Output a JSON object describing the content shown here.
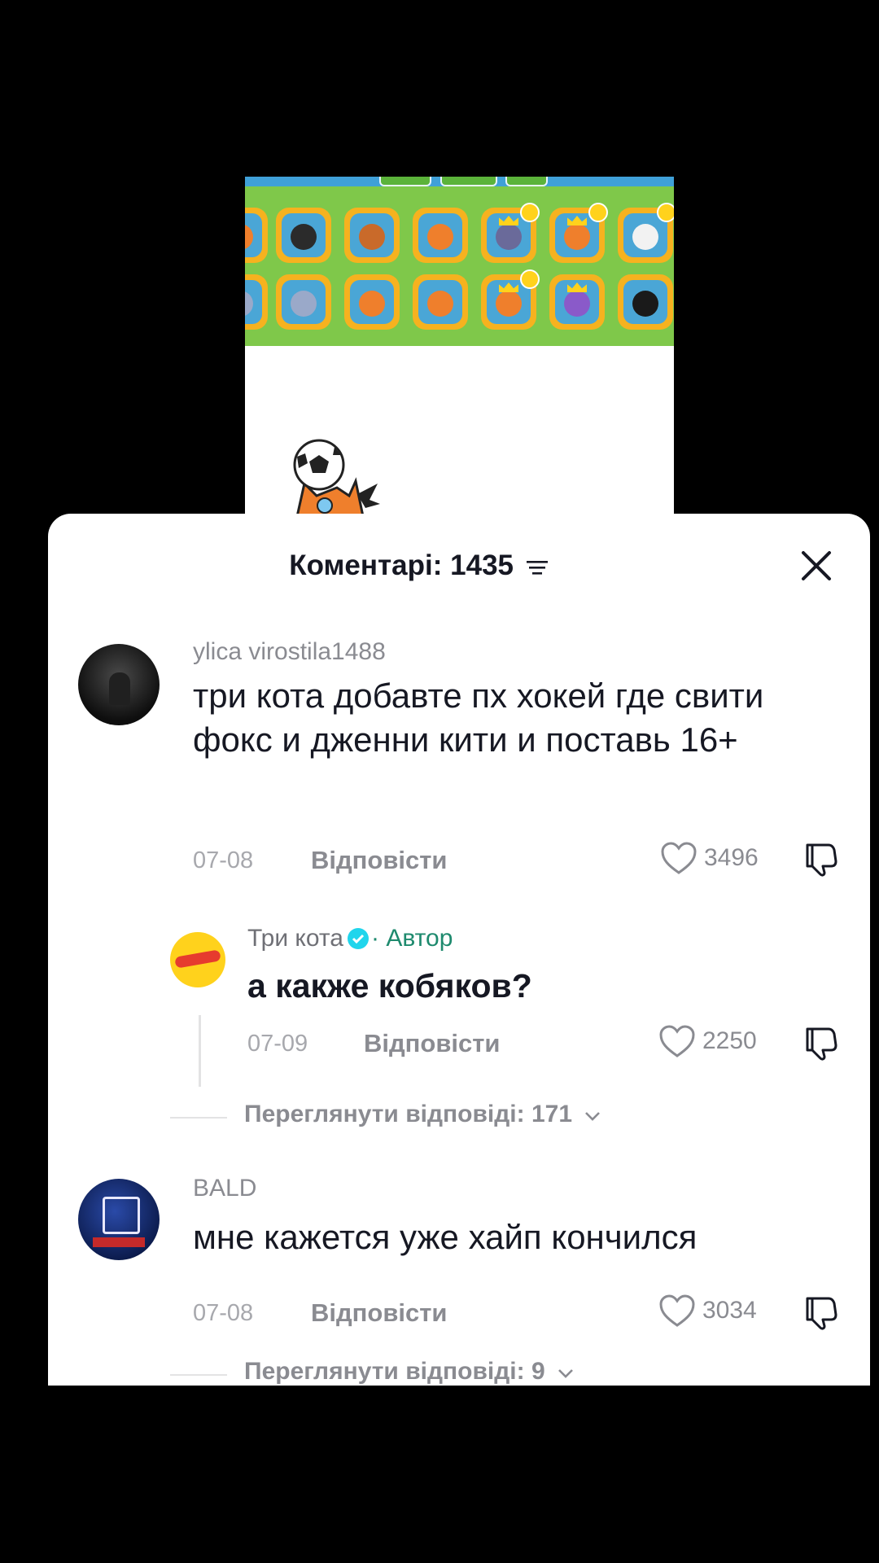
{
  "header": {
    "title": "Коментарі: 1435"
  },
  "comments": [
    {
      "username": "ylica virostila1488",
      "text": "три кота добавте пх хокей где свити фокс и дженни кити и поставь 16+",
      "date": "07-08",
      "reply_label": "Відповісти",
      "likes": "3496",
      "reply": {
        "username": "Три кота",
        "author_tag": "· Автор",
        "text": "а  какже  кобяков?",
        "date": "07-09",
        "reply_label": "Відповісти",
        "likes": "2250"
      },
      "view_replies": "Переглянути відповіді: 171"
    },
    {
      "username": "BALD",
      "text": "мне кажется уже хайп кончился",
      "date": "07-08",
      "reply_label": "Відповісти",
      "likes": "3034",
      "view_replies": "Переглянути відповіді: 9"
    }
  ],
  "colors": {
    "sheet": "#ffffff",
    "author": "#1e8a6e",
    "verified": "#20d5ec",
    "game_bg": "#7fc84a",
    "tile": "#f6b21f"
  },
  "icons": [
    "sort-icon",
    "close-icon",
    "verified-icon",
    "heart-icon",
    "dislike-icon",
    "chevron-down-icon"
  ]
}
